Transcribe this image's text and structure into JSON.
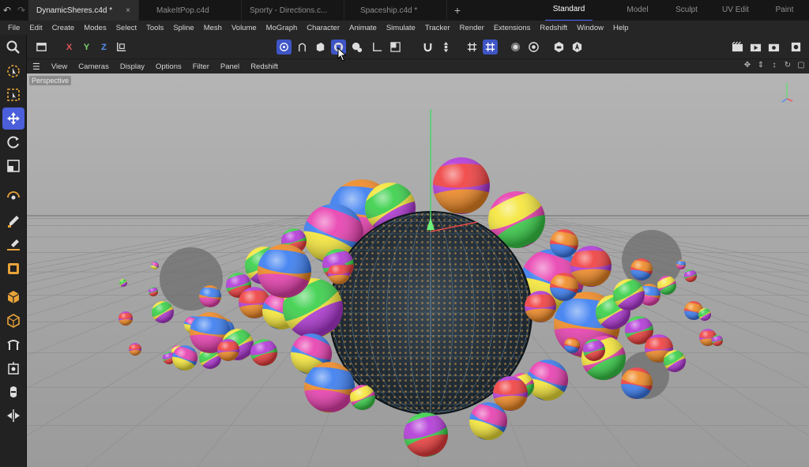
{
  "tabbar": {
    "tabs": [
      {
        "label": "DynamicSheres.c4d *",
        "active": true,
        "close": "×"
      },
      {
        "label": "MakeItPop.c4d",
        "active": false
      },
      {
        "label": "Sporty - Directions.c...",
        "active": false
      },
      {
        "label": "Spaceship.c4d *",
        "active": false
      }
    ],
    "add_label": "+",
    "layouts": [
      "Standard",
      "Model",
      "Sculpt",
      "UV Edit",
      "Paint"
    ],
    "active_layout": "Standard"
  },
  "menubar": {
    "items": [
      "File",
      "Edit",
      "Create",
      "Modes",
      "Select",
      "Tools",
      "Spline",
      "Mesh",
      "Volume",
      "MoGraph",
      "Character",
      "Animate",
      "Simulate",
      "Tracker",
      "Render",
      "Extensions",
      "Redshift",
      "Window",
      "Help"
    ]
  },
  "toolbar": {
    "axis_x": "X",
    "axis_y": "Y",
    "axis_z": "Z"
  },
  "viewmenu": {
    "items": [
      "View",
      "Cameras",
      "Display",
      "Options",
      "Filter",
      "Panel",
      "Redshift"
    ]
  },
  "viewport": {
    "label": "Perspective"
  },
  "colors": {
    "accent": "#4a5fd9",
    "toolbar_bg": "#262626",
    "ball_colors": [
      "#f5e63a",
      "#f08a26",
      "#3ad04a",
      "#3b7df0",
      "#b33ad8",
      "#e840b0",
      "#f04040"
    ]
  }
}
